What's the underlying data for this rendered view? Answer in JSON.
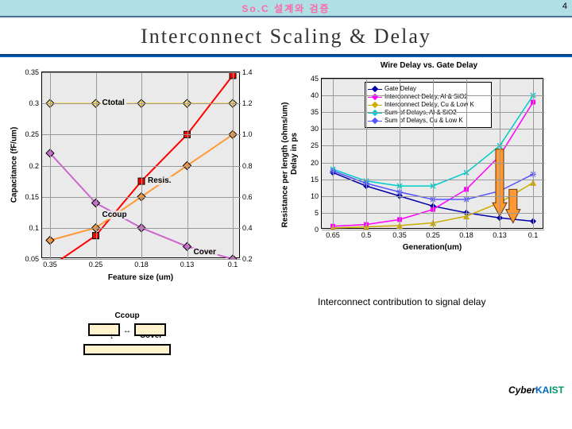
{
  "topbar": {
    "title": "So.C 설계와 검증",
    "page_num": "4"
  },
  "header": {
    "title": "Interconnect Scaling & Delay"
  },
  "chart_data": [
    {
      "type": "line",
      "title": "",
      "xlabel": "Feature size (um)",
      "ylabel_left": "Capacitance (fF/um)",
      "ylabel_right": "Resistance per length (ohms/um)",
      "categories": [
        "0.35",
        "0.25",
        "0.18",
        "0.13",
        "0.1"
      ],
      "yticks_left": [
        "0.35",
        "0.3",
        "0.25",
        "0.2",
        "0.15",
        "0.1",
        "0.05"
      ],
      "yticks_right": [
        "1.4",
        "1.2",
        "1.0",
        "0.8",
        "0.6",
        "0.4",
        "0.2"
      ],
      "series": [
        {
          "name": "Ctotal",
          "color": "#ffd966",
          "marker": "diamond",
          "values": [
            0.3,
            0.3,
            0.3,
            0.3,
            0.3
          ],
          "axis": "left",
          "ann": "Ctotal",
          "ann_xy": [
            1,
            0.3
          ]
        },
        {
          "name": "Resis.",
          "color": "#ff0000",
          "marker": "square",
          "values": [
            0.15,
            0.35,
            0.7,
            1.0,
            1.38
          ],
          "axis": "right",
          "ann": "Resis.",
          "ann_xy": [
            2,
            0.7
          ]
        },
        {
          "name": "Ccoup",
          "color": "#ff9933",
          "marker": "diamond",
          "values": [
            0.08,
            0.1,
            0.15,
            0.2,
            0.25
          ],
          "axis": "left",
          "ann": "Ccoup",
          "ann_xy": [
            1,
            0.12
          ]
        },
        {
          "name": "Cover",
          "color": "#cc66cc",
          "marker": "diamond",
          "values": [
            0.22,
            0.14,
            0.1,
            0.07,
            0.05
          ],
          "axis": "left",
          "ann": "Cover",
          "ann_xy": [
            3,
            0.06
          ]
        }
      ]
    },
    {
      "type": "line",
      "title": "Wire Delay vs. Gate Delay",
      "xlabel": "Generation(um)",
      "ylabel_left": "Delay in ps",
      "categories": [
        "0.65",
        "0.5",
        "0.35",
        "0.25",
        "0.18",
        "0.13",
        "0.1"
      ],
      "yticks_left": [
        "45",
        "40",
        "35",
        "30",
        "25",
        "20",
        "15",
        "10",
        "5",
        "0"
      ],
      "series": [
        {
          "name": "Gate Delay",
          "color": "#0000aa",
          "values": [
            17,
            13,
            10,
            7,
            5,
            3.5,
            2.5
          ]
        },
        {
          "name": "Interconnect Delay, Al & SiO2",
          "color": "#ff00ff",
          "values": [
            1,
            1.5,
            3,
            6,
            12,
            22,
            38
          ]
        },
        {
          "name": "Interconnect Delay, Cu & Low K",
          "color": "#ccaa00",
          "values": [
            0.5,
            0.8,
            1.2,
            2,
            4,
            8,
            14
          ]
        },
        {
          "name": "Sum of Delays, Al & SiO2",
          "color": "#00cccc",
          "values": [
            18,
            14.5,
            13,
            13,
            17,
            25,
            40
          ]
        },
        {
          "name": "Sum of Delays, Cu & Low K",
          "color": "#5555ff",
          "values": [
            17.5,
            13.8,
            11.2,
            9,
            9,
            11.5,
            16.5
          ]
        }
      ],
      "legend_labels": [
        "Gate Delay",
        "Interconnect Delay, Al & SiO2",
        "Interconnect Delay, Cu & Low K",
        "Sum of Delays, Al & SiO2",
        "Sum of Delays, Cu & Low K"
      ]
    }
  ],
  "diagram": {
    "title": "Ccoup",
    "label2": "Cover"
  },
  "caption": "Interconnect contribution to signal delay",
  "footer": {
    "brand_cyber": "Cyber",
    "brand_ka": "KA",
    "brand_ist": "IST"
  }
}
